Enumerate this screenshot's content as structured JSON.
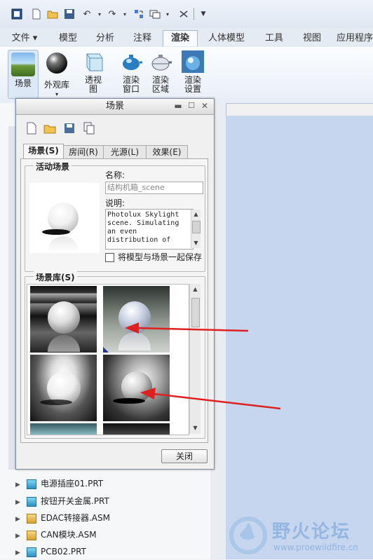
{
  "ribbon_tabs": [
    {
      "label": "文件 ▾",
      "active": false
    },
    {
      "label": "模型",
      "active": false
    },
    {
      "label": "分析",
      "active": false
    },
    {
      "label": "注释",
      "active": false
    },
    {
      "label": "渲染",
      "active": true
    },
    {
      "label": "人体模型",
      "active": false
    },
    {
      "label": "工具",
      "active": false
    },
    {
      "label": "视图",
      "active": false
    },
    {
      "label": "应用程序",
      "active": false
    }
  ],
  "ribbon_buttons": [
    {
      "label": "场景",
      "icon": "scene-icon"
    },
    {
      "label": "外观库",
      "icon": "appearance-gallery-icon"
    },
    {
      "label": "透视\n图",
      "icon": "perspective-icon"
    },
    {
      "label": "渲染\n窗口",
      "icon": "render-window-icon"
    },
    {
      "label": "渲染\n区域",
      "icon": "render-region-icon"
    },
    {
      "label": "渲染\n设置",
      "icon": "render-setup-icon"
    }
  ],
  "dialog": {
    "title": "场景",
    "tabs": [
      "场景(S)",
      "房间(R)",
      "光源(L)",
      "效果(E)"
    ],
    "active_scene_label": "活动场景",
    "name_label": "名称:",
    "name_value": "结构机箱_scene",
    "desc_label": "说明:",
    "desc_value": "Photolux Skylight scene. Simulating an even distribution of",
    "save_checkbox_label": "将模型与场景一起保存",
    "library_label": "场景库(S)",
    "close_button": "关闭"
  },
  "tree_items": [
    {
      "label": "电源插座01.PRT",
      "type": "part"
    },
    {
      "label": "按钮开关金属.PRT",
      "type": "part"
    },
    {
      "label": "EDAC转接器.ASM",
      "type": "assembly"
    },
    {
      "label": "CAN模块.ASM",
      "type": "assembly"
    },
    {
      "label": "PCB02.PRT",
      "type": "part"
    }
  ],
  "watermark": {
    "title": "野火论坛",
    "url": "www.proewildfire.cn"
  },
  "colors": {
    "arrow": "#e02020",
    "viewport": "#c5d6ee",
    "ribbon": "#e5ebf3"
  }
}
